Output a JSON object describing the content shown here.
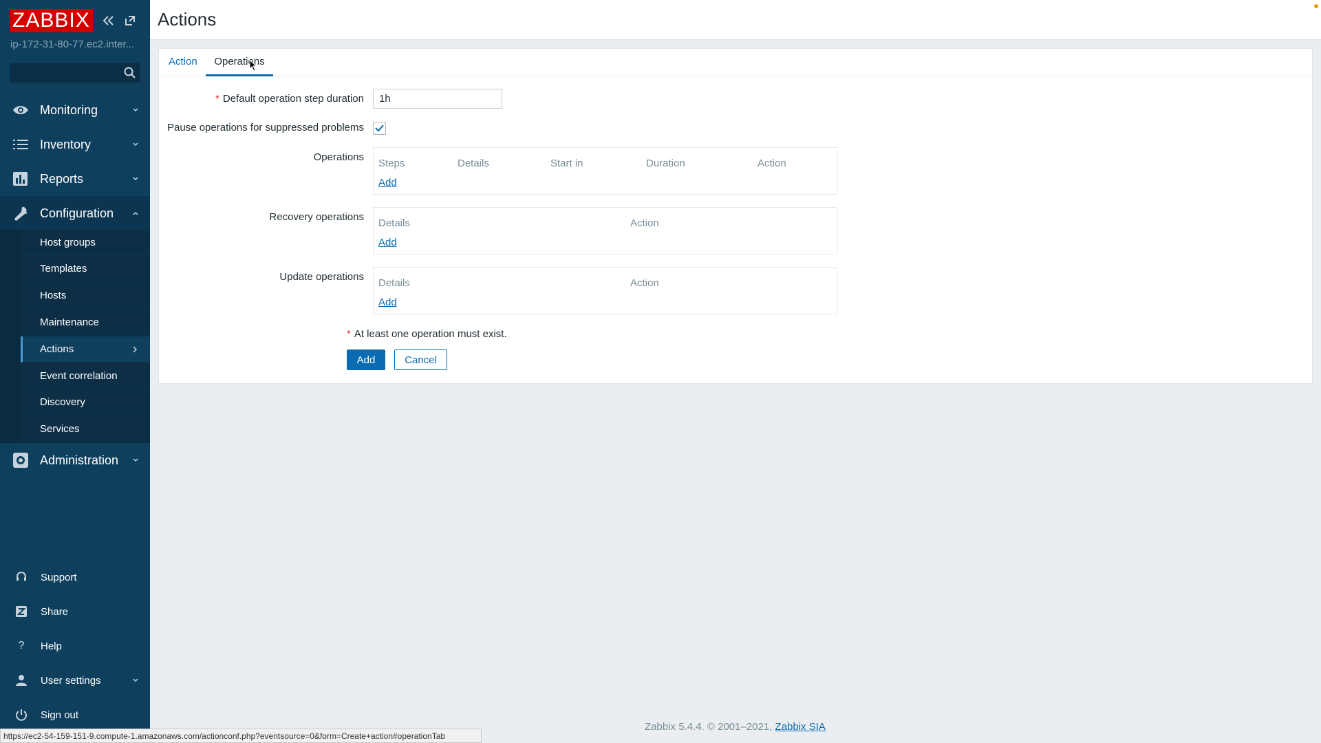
{
  "app": {
    "logo": "ZABBIX",
    "server_name": "ip-172-31-80-77.ec2.inter...",
    "search_placeholder": ""
  },
  "sidebar": {
    "menu": [
      {
        "label": "Monitoring",
        "icon": "eye-icon"
      },
      {
        "label": "Inventory",
        "icon": "list-icon"
      },
      {
        "label": "Reports",
        "icon": "bar-chart-icon"
      },
      {
        "label": "Configuration",
        "icon": "wrench-icon"
      },
      {
        "label": "Administration",
        "icon": "gear-icon"
      }
    ],
    "config_items": [
      "Host groups",
      "Templates",
      "Hosts",
      "Maintenance",
      "Actions",
      "Event correlation",
      "Discovery",
      "Services"
    ],
    "active_item": "Actions",
    "bottom": [
      {
        "label": "Support",
        "icon": "headset-icon"
      },
      {
        "label": "Share",
        "icon": "share-icon"
      },
      {
        "label": "Help",
        "icon": "help-icon"
      },
      {
        "label": "User settings",
        "icon": "user-icon"
      },
      {
        "label": "Sign out",
        "icon": "power-icon"
      }
    ]
  },
  "page": {
    "title": "Actions"
  },
  "tabs": [
    {
      "label": "Action",
      "active": false
    },
    {
      "label": "Operations",
      "active": true
    }
  ],
  "form": {
    "step_duration_label": "Default operation step duration",
    "step_duration_value": "1h",
    "pause_label": "Pause operations for suppressed problems",
    "pause_checked": true,
    "operations_label": "Operations",
    "operations_headers": [
      "Steps",
      "Details",
      "Start in",
      "Duration",
      "Action"
    ],
    "recovery_label": "Recovery operations",
    "recovery_headers": [
      "Details",
      "Action"
    ],
    "update_label": "Update operations",
    "update_headers": [
      "Details",
      "Action"
    ],
    "add_link": "Add",
    "note": "At least one operation must exist.",
    "add_button": "Add",
    "cancel_button": "Cancel"
  },
  "footer": {
    "text": "Zabbix 5.4.4. © 2001–2021,",
    "link": "Zabbix SIA"
  },
  "statusbar": {
    "url": "https://ec2-54-159-151-9.compute-1.amazonaws.com/actionconf.php?eventsource=0&form=Create+action#operationTab"
  },
  "colors": {
    "sidebar": "#0e3f5d",
    "logo_bg": "#d40000",
    "accent": "#0b6bb0",
    "required": "#e33734"
  }
}
